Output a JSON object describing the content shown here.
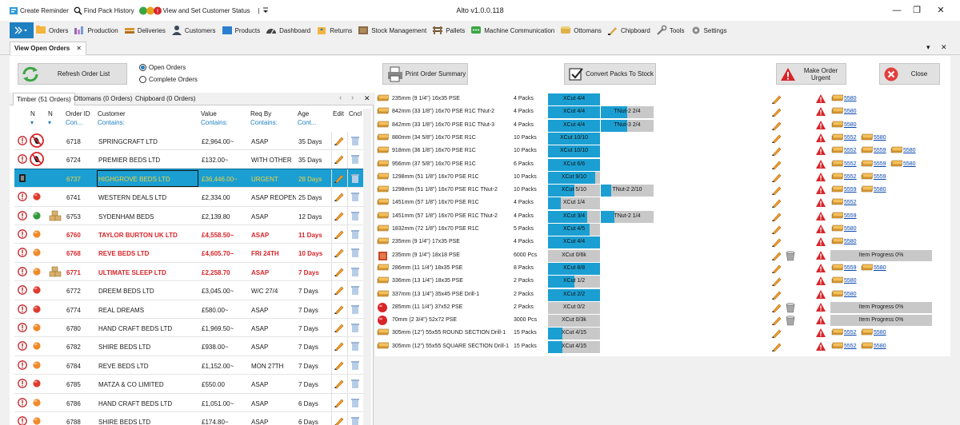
{
  "app": {
    "title": "Alto v1.0.0.118"
  },
  "quick_access": {
    "items": [
      {
        "label": "Create Reminder",
        "icon": "reminder-icon"
      },
      {
        "label": "Find Pack History",
        "icon": "search-icon"
      },
      {
        "label": "View and Set Customer Status",
        "icon": "status-icon"
      }
    ],
    "separator": "|"
  },
  "window_controls": {
    "minimize": "—",
    "restore": "❐",
    "close": "✕"
  },
  "nav": {
    "items": [
      {
        "label": "Orders",
        "icon": "orders-icon"
      },
      {
        "label": "Production",
        "icon": "production-icon"
      },
      {
        "label": "Deliveries",
        "icon": "deliveries-icon"
      },
      {
        "label": "Customers",
        "icon": "customers-icon"
      },
      {
        "label": "Products",
        "icon": "products-icon"
      },
      {
        "label": "Dashboard",
        "icon": "dashboard-icon"
      },
      {
        "label": "Returns",
        "icon": "returns-icon"
      },
      {
        "label": "Stock Management",
        "icon": "stock-icon"
      },
      {
        "label": "Pallets",
        "icon": "pallets-icon"
      },
      {
        "label": "Machine Communication",
        "icon": "machine-icon"
      },
      {
        "label": "Ottomans",
        "icon": "ottomans-icon"
      },
      {
        "label": "Chipboard",
        "icon": "chipboard-icon"
      },
      {
        "label": "Tools",
        "icon": "tools-icon"
      },
      {
        "label": "Settings",
        "icon": "gear-icon"
      }
    ]
  },
  "doc_tab": {
    "label": "View Open Orders",
    "close": "✕"
  },
  "tab_controls": {
    "dropdown": "▾",
    "close": "✕"
  },
  "toolbar": {
    "refresh": "Refresh Order List",
    "print": "Print Order Summary",
    "convert": "Convert Packs To Stock",
    "urgent": "Make Order Urgent",
    "close": "Close",
    "radio_open": "Open Orders",
    "radio_complete": "Complete Orders"
  },
  "left_tabs": {
    "tabs": [
      "Timber (51 Orders)",
      "Ottomans (0 Orders)",
      "Chipboard (0 Orders)"
    ],
    "prev": "‹",
    "next": "›",
    "close": "✕"
  },
  "orders_grid": {
    "headers": {
      "n1": "N",
      "n2": "N",
      "order_id": "Order ID",
      "customer": "Customer",
      "value": "Value",
      "req_by": "Req By",
      "age": "Age",
      "edit": "Edit",
      "cncl": "Cncl"
    },
    "filters": {
      "order_id": "Con...",
      "customer": "Contains:",
      "value": "Contains:",
      "req_by": "Contains:",
      "age": "Cont..."
    },
    "rows": [
      {
        "id": "6718",
        "customer": "SPRINGCRAFT LTD",
        "value": "£2,964.00~",
        "req": "ASAP",
        "age": "35 Days",
        "status": "blocked",
        "dot": "",
        "box": false,
        "style": "",
        "alert": true
      },
      {
        "id": "6724",
        "customer": "PREMIER BEDS LTD",
        "value": "£132.00~",
        "req": "WITH OTHER",
        "age": "35 Days",
        "status": "blocked",
        "dot": "",
        "box": false,
        "style": "",
        "alert": true
      },
      {
        "id": "6737",
        "customer": "HIGHGROVE BEDS LTD",
        "value": "£36,446.00~",
        "req": "URGENT",
        "age": "28 Days",
        "status": "flag",
        "dot": "",
        "box": false,
        "style": "sel",
        "alert": false
      },
      {
        "id": "6741",
        "customer": "WESTERN DEALS LTD",
        "value": "£2,334.00",
        "req": "ASAP REOPEN",
        "age": "25 Days",
        "status": "",
        "dot": "red",
        "box": false,
        "style": "",
        "alert": true
      },
      {
        "id": "6753",
        "customer": "SYDENHAM BEDS",
        "value": "£2,139.80",
        "req": "ASAP",
        "age": "12 Days",
        "status": "",
        "dot": "green",
        "box": true,
        "style": "",
        "alert": true
      },
      {
        "id": "6760",
        "customer": "TAYLOR BURTON  UK LTD",
        "value": "£4,558.50~",
        "req": "ASAP",
        "age": "11 Days",
        "status": "",
        "dot": "orange",
        "box": false,
        "style": "red",
        "alert": true
      },
      {
        "id": "6768",
        "customer": "REVE BEDS LTD",
        "value": "£4,605.70~",
        "req": "FRI 24TH",
        "age": "10 Days",
        "status": "",
        "dot": "orange",
        "box": false,
        "style": "red",
        "alert": true
      },
      {
        "id": "6771",
        "customer": "ULTIMATE SLEEP LTD",
        "value": "£2,258.70",
        "req": "ASAP",
        "age": "7 Days",
        "status": "",
        "dot": "orange",
        "box": true,
        "style": "red",
        "alert": true
      },
      {
        "id": "6772",
        "customer": "DREEM BEDS LTD",
        "value": "£3,045.00~",
        "req": "W/C 27/4",
        "age": "7 Days",
        "status": "",
        "dot": "red",
        "box": false,
        "style": "",
        "alert": true
      },
      {
        "id": "6774",
        "customer": "REAL DREAMS",
        "value": "£580.00~",
        "req": "ASAP",
        "age": "7 Days",
        "status": "",
        "dot": "red",
        "box": false,
        "style": "",
        "alert": true
      },
      {
        "id": "6780",
        "customer": "HAND CRAFT BEDS LTD",
        "value": "£1,969.50~",
        "req": "ASAP",
        "age": "7 Days",
        "status": "",
        "dot": "orange",
        "box": false,
        "style": "",
        "alert": true
      },
      {
        "id": "6782",
        "customer": "SHIRE BEDS LTD",
        "value": "£938.00~",
        "req": "ASAP",
        "age": "7 Days",
        "status": "",
        "dot": "orange",
        "box": false,
        "style": "",
        "alert": true
      },
      {
        "id": "6784",
        "customer": "REVE BEDS LTD",
        "value": "£1,152.00~",
        "req": "MON 27TH",
        "age": "7 Days",
        "status": "",
        "dot": "orange",
        "box": false,
        "style": "",
        "alert": true
      },
      {
        "id": "6785",
        "customer": "MATZA & CO LIMITED",
        "value": "£550.00",
        "req": "ASAP",
        "age": "7 Days",
        "status": "",
        "dot": "red",
        "box": false,
        "style": "",
        "alert": true
      },
      {
        "id": "6786",
        "customer": "HAND CRAFT BEDS LTD",
        "value": "£1,051.00~",
        "req": "ASAP",
        "age": "6 Days",
        "status": "",
        "dot": "orange",
        "box": false,
        "style": "",
        "alert": true
      },
      {
        "id": "6788",
        "customer": "SHIRE BEDS LTD",
        "value": "£174.80~",
        "req": "ASAP",
        "age": "6 Days",
        "status": "",
        "dot": "orange",
        "box": false,
        "style": "",
        "alert": true
      }
    ]
  },
  "lines_grid": {
    "rows": [
      {
        "product": "235mm (9 1/4\") 16x35 PSE",
        "qty": "4 Packs",
        "bar1": {
          "text": "XCut 4/4",
          "fill": 1.0
        },
        "bar2": null,
        "bin": false,
        "links": [
          "5580"
        ],
        "progress": null,
        "picon": "pack"
      },
      {
        "product": "842mm (33 1/8\") 16x70 PSE R1C TNut-2",
        "qty": "4 Packs",
        "bar1": {
          "text": "XCut 4/4",
          "fill": 1.0
        },
        "bar2": {
          "text": "TNut-2 2/4",
          "fill": 0.5
        },
        "bin": false,
        "links": [
          "5580"
        ],
        "progress": null,
        "picon": "pack"
      },
      {
        "product": "842mm (33 1/8\") 16x70 PSE R1C TNut-3",
        "qty": "4 Packs",
        "bar1": {
          "text": "XCut 4/4",
          "fill": 1.0
        },
        "bar2": {
          "text": "TNut-3 2/4",
          "fill": 0.5
        },
        "bin": false,
        "links": [
          "5580"
        ],
        "progress": null,
        "picon": "pack"
      },
      {
        "product": "880mm (34 5/8\") 16x70 PSE R1C",
        "qty": "10 Packs",
        "bar1": {
          "text": "XCut 10/10",
          "fill": 1.0
        },
        "bar2": null,
        "bin": false,
        "links": [
          "5552",
          "5580"
        ],
        "progress": null,
        "picon": "pack"
      },
      {
        "product": "918mm (36 1/8\") 16x70 PSE R1C",
        "qty": "10 Packs",
        "bar1": {
          "text": "XCut 10/10",
          "fill": 1.0
        },
        "bar2": null,
        "bin": false,
        "links": [
          "5552",
          "5559",
          "5580"
        ],
        "progress": null,
        "picon": "pack"
      },
      {
        "product": "956mm (37 5/8\") 16x70 PSE R1C",
        "qty": "6 Packs",
        "bar1": {
          "text": "XCut 6/6",
          "fill": 1.0
        },
        "bar2": null,
        "bin": false,
        "links": [
          "5552",
          "5559",
          "5580"
        ],
        "progress": null,
        "picon": "pack"
      },
      {
        "product": "1298mm (51 1/8\") 16x70 PSE R1C",
        "qty": "10 Packs",
        "bar1": {
          "text": "XCut 9/10",
          "fill": 0.9
        },
        "bar2": null,
        "bin": false,
        "links": [
          "5552",
          "5559"
        ],
        "progress": null,
        "picon": "pack"
      },
      {
        "product": "1298mm (51 1/8\") 16x70 PSE R1C TNut-2",
        "qty": "10 Packs",
        "bar1": {
          "text": "XCut 5/10",
          "fill": 0.5
        },
        "bar2": {
          "text": "TNut-2 2/10",
          "fill": 0.2
        },
        "bin": false,
        "links": [
          "5559",
          "5580"
        ],
        "progress": null,
        "picon": "pack"
      },
      {
        "product": "1451mm (57 1/8\") 16x70 PSE R1C",
        "qty": "4 Packs",
        "bar1": {
          "text": "XCut 1/4",
          "fill": 0.25
        },
        "bar2": null,
        "bin": false,
        "links": [
          "5552"
        ],
        "progress": null,
        "picon": "pack"
      },
      {
        "product": "1451mm (57 1/8\") 16x70 PSE R1C TNut-2",
        "qty": "4 Packs",
        "bar1": {
          "text": "XCut 3/4",
          "fill": 0.75
        },
        "bar2": {
          "text": "TNut-2 1/4",
          "fill": 0.25
        },
        "bin": false,
        "links": [
          "5559"
        ],
        "progress": null,
        "picon": "pack"
      },
      {
        "product": "1832mm (72 1/8\") 16x70 PSE R1C",
        "qty": "5 Packs",
        "bar1": {
          "text": "XCut 4/5",
          "fill": 0.8
        },
        "bar2": null,
        "bin": false,
        "links": [
          "5580"
        ],
        "progress": null,
        "picon": "pack"
      },
      {
        "product": "235mm (9 1/4\") 17x35 PSE",
        "qty": "4 Packs",
        "bar1": {
          "text": "XCut 4/4",
          "fill": 1.0
        },
        "bar2": null,
        "bin": false,
        "links": [
          "5580"
        ],
        "progress": null,
        "picon": "pack"
      },
      {
        "product": "235mm (9 1/4\") 18x18 PSE",
        "qty": "6000 Pcs",
        "bar1": {
          "text": "XCut 0/6k",
          "fill": 0.0
        },
        "bar2": null,
        "bin": true,
        "links": [],
        "progress": "Item Progress 0%",
        "picon": "box"
      },
      {
        "product": "286mm (11 1/4\") 18x35 PSE",
        "qty": "8 Packs",
        "bar1": {
          "text": "XCut 8/8",
          "fill": 1.0
        },
        "bar2": null,
        "bin": false,
        "links": [
          "5559",
          "5580"
        ],
        "progress": null,
        "picon": "pack"
      },
      {
        "product": "336mm (13 1/4\") 18x35 PSE",
        "qty": "2 Packs",
        "bar1": {
          "text": "XCut 1/2",
          "fill": 0.5
        },
        "bar2": null,
        "bin": false,
        "links": [
          "5580"
        ],
        "progress": null,
        "picon": "pack"
      },
      {
        "product": "337mm (13 1/4\") 35x45 PSE Drill-1",
        "qty": "2 Packs",
        "bar1": {
          "text": "XCut 2/2",
          "fill": 1.0
        },
        "bar2": null,
        "bin": false,
        "links": [
          "5580"
        ],
        "progress": null,
        "picon": "pack"
      },
      {
        "product": "285mm (11 1/4\") 37x52 PSE",
        "qty": "2 Packs",
        "bar1": {
          "text": "XCut 0/2",
          "fill": 0.0
        },
        "bar2": null,
        "bin": true,
        "links": [],
        "progress": "Item Progress 0%",
        "picon": "redball"
      },
      {
        "product": "70mm (2 3/4\") 52x72 PSE",
        "qty": "3000 Pcs",
        "bar1": {
          "text": "XCut 0/3k",
          "fill": 0.0
        },
        "bar2": null,
        "bin": true,
        "links": [],
        "progress": "Item Progress 0%",
        "picon": "redball"
      },
      {
        "product": "305mm (12\") 55x55 ROUND SECTION Drill-1",
        "qty": "15 Packs",
        "bar1": {
          "text": "XCut 4/15",
          "fill": 0.27
        },
        "bar2": null,
        "bin": false,
        "links": [
          "5552",
          "5580"
        ],
        "progress": null,
        "picon": "pack"
      },
      {
        "product": "305mm (12\") 55x55 SQUARE SECTION Drill-1",
        "qty": "15 Packs",
        "bar1": {
          "text": "XCut 4/15",
          "fill": 0.27
        },
        "bar2": null,
        "bin": false,
        "links": [
          "5552",
          "5580"
        ],
        "progress": null,
        "picon": "pack"
      }
    ]
  },
  "colors": {
    "accent": "#1b9fd2",
    "alert": "#d8252a",
    "selected_text": "#f3d23a",
    "nav_active": "#1e7fc1"
  }
}
